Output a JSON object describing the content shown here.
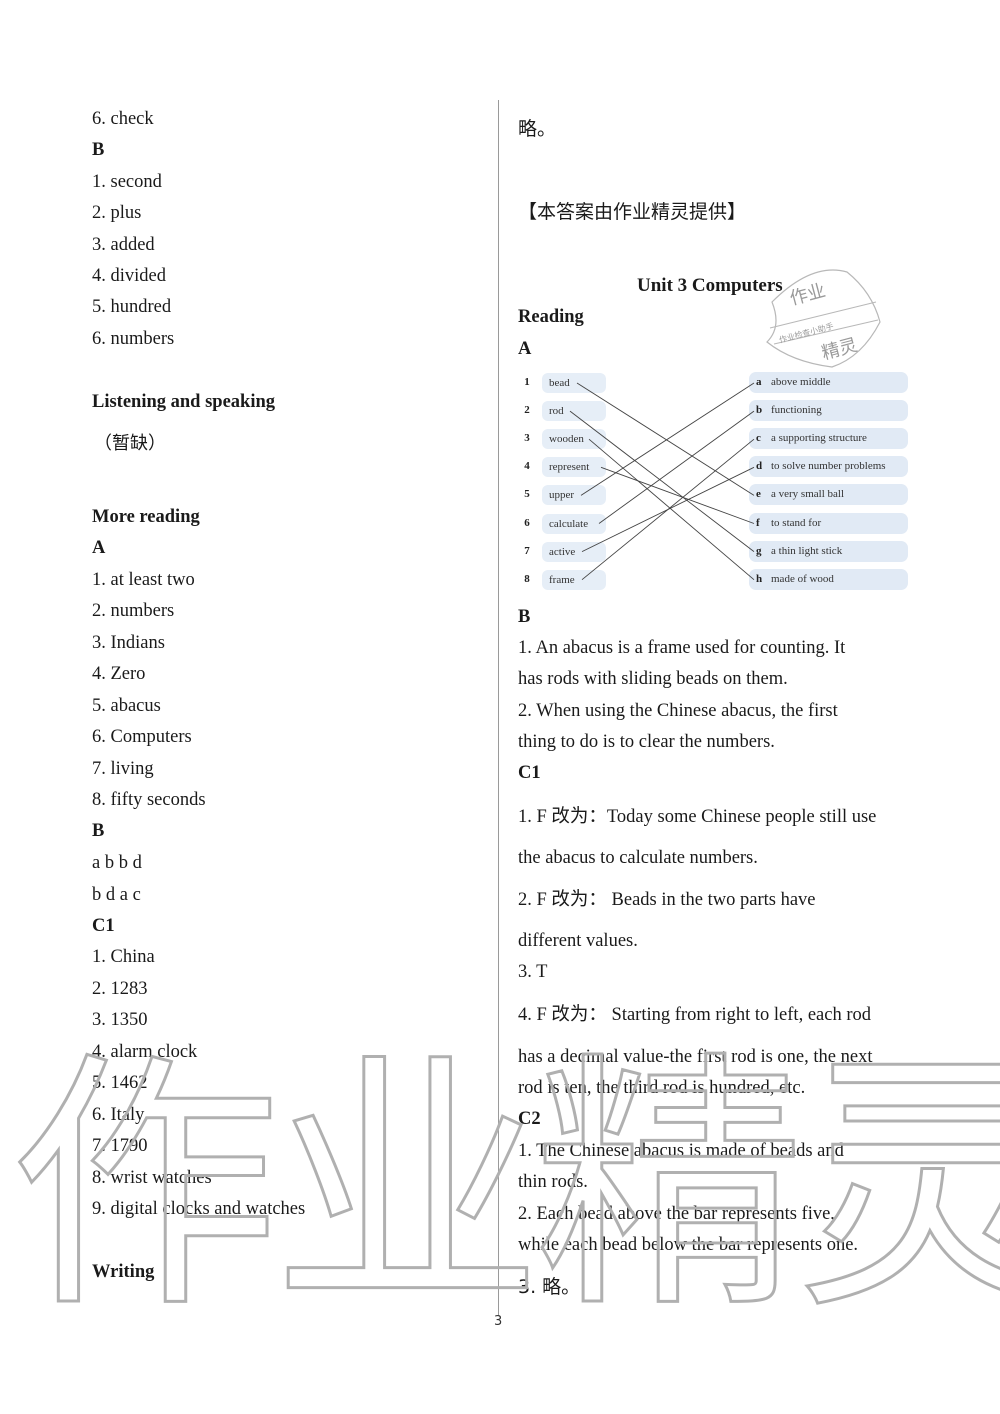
{
  "left_column": [
    {
      "text": "6. check",
      "style": "normal"
    },
    {
      "text": "B",
      "style": "bold"
    },
    {
      "text": "1. second",
      "style": "normal"
    },
    {
      "text": "2. plus",
      "style": "normal"
    },
    {
      "text": "3. added",
      "style": "normal"
    },
    {
      "text": "4. divided",
      "style": "normal"
    },
    {
      "text": "5. hundred",
      "style": "normal"
    },
    {
      "text": "6. numbers",
      "style": "normal"
    },
    {
      "text": "Listening and speaking",
      "style": "bold"
    },
    {
      "text": "（暂缺）",
      "style": "cjk"
    },
    {
      "text": "More reading",
      "style": "bold"
    },
    {
      "text": "A",
      "style": "bold"
    },
    {
      "text": "1. at least two",
      "style": "normal"
    },
    {
      "text": "2. numbers",
      "style": "normal"
    },
    {
      "text": "3. Indians",
      "style": "normal"
    },
    {
      "text": "4. Zero",
      "style": "normal"
    },
    {
      "text": "5. abacus",
      "style": "normal"
    },
    {
      "text": "6. Computers",
      "style": "normal"
    },
    {
      "text": "7. living",
      "style": "normal"
    },
    {
      "text": "8. fifty seconds",
      "style": "normal"
    },
    {
      "text": "B",
      "style": "bold"
    },
    {
      "text": "a b b d",
      "style": "normal"
    },
    {
      "text": "b d a c",
      "style": "normal"
    },
    {
      "text": "C1",
      "style": "bold"
    },
    {
      "text": "1. China",
      "style": "normal"
    },
    {
      "text": "2. 1283",
      "style": "normal"
    },
    {
      "text": "3. 1350",
      "style": "normal"
    },
    {
      "text": "4. alarm clock",
      "style": "normal"
    },
    {
      "text": "5. 1462",
      "style": "normal"
    },
    {
      "text": "6. Italy",
      "style": "normal"
    },
    {
      "text": "7. 1790",
      "style": "normal"
    },
    {
      "text": "8. wrist watches",
      "style": "normal"
    },
    {
      "text": "9. digital clocks and watches",
      "style": "normal"
    },
    {
      "text": "Writing",
      "style": "bold"
    }
  ],
  "right_column": {
    "omitted": "略。",
    "credit": "【本答案由作业精灵提供】",
    "unit_title": "Unit 3 Computers",
    "reading_heading": "Reading",
    "section_a": "A",
    "matching": {
      "words": [
        {
          "num": "1",
          "word": "bead"
        },
        {
          "num": "2",
          "word": "rod"
        },
        {
          "num": "3",
          "word": "wooden"
        },
        {
          "num": "4",
          "word": "represent"
        },
        {
          "num": "5",
          "word": "upper"
        },
        {
          "num": "6",
          "word": "calculate"
        },
        {
          "num": "7",
          "word": "active"
        },
        {
          "num": "8",
          "word": "frame"
        }
      ],
      "definitions": [
        {
          "letter": "a",
          "text": "above middle"
        },
        {
          "letter": "b",
          "text": "functioning"
        },
        {
          "letter": "c",
          "text": "a supporting structure"
        },
        {
          "letter": "d",
          "text": "to solve number problems"
        },
        {
          "letter": "e",
          "text": "a very small ball"
        },
        {
          "letter": "f",
          "text": "to stand for"
        },
        {
          "letter": "g",
          "text": "a thin light stick"
        },
        {
          "letter": "h",
          "text": "made of wood"
        }
      ],
      "answers": {
        "1": "e",
        "2": "g",
        "3": "h",
        "4": "f",
        "5": "a",
        "6": "b",
        "7": "d",
        "8": "c"
      }
    },
    "lines": [
      {
        "text": "B",
        "style": "bold"
      },
      {
        "text": "1.  An abacus is a frame used for counting. It",
        "style": "normal"
      },
      {
        "text": "has rods with sliding beads on them.",
        "style": "normal"
      },
      {
        "text": "2.  When using the Chinese abacus, the first",
        "style": "normal"
      },
      {
        "text": "thing to do is to clear the numbers.",
        "style": "normal"
      },
      {
        "text": "C1",
        "style": "bold"
      },
      {
        "text": "1.  F  改为：Today some Chinese people still use",
        "style": "normal"
      },
      {
        "text": "the abacus to calculate numbers.",
        "style": "normal"
      },
      {
        "text": "2.  F  改为：  Beads in the two parts have",
        "style": "normal"
      },
      {
        "text": "different values.",
        "style": "normal"
      },
      {
        "text": "3.  T",
        "style": "normal"
      },
      {
        "text": "4.  F  改为：  Starting from right to left, each rod",
        "style": "normal"
      },
      {
        "text": "has a decimal value-the first rod is one, the next",
        "style": "normal"
      },
      {
        "text": "rod is ten, the third rod is hundred, etc.",
        "style": "normal"
      },
      {
        "text": "C2",
        "style": "bold"
      },
      {
        "text": "1.  The Chinese abacus is made of beads and",
        "style": "normal"
      },
      {
        "text": "thin rods.",
        "style": "normal"
      },
      {
        "text": "2.  Each bead above the bar represents five,",
        "style": "normal"
      },
      {
        "text": "while each bead below the bar represents one.",
        "style": "normal"
      },
      {
        "text": "3.  略。",
        "style": "cjk"
      }
    ]
  },
  "page_number": "3",
  "watermark": {
    "large_text": "作业精灵",
    "stamp_top": "作业",
    "stamp_middle": "作业检查小助手",
    "stamp_bottom": "精灵"
  }
}
